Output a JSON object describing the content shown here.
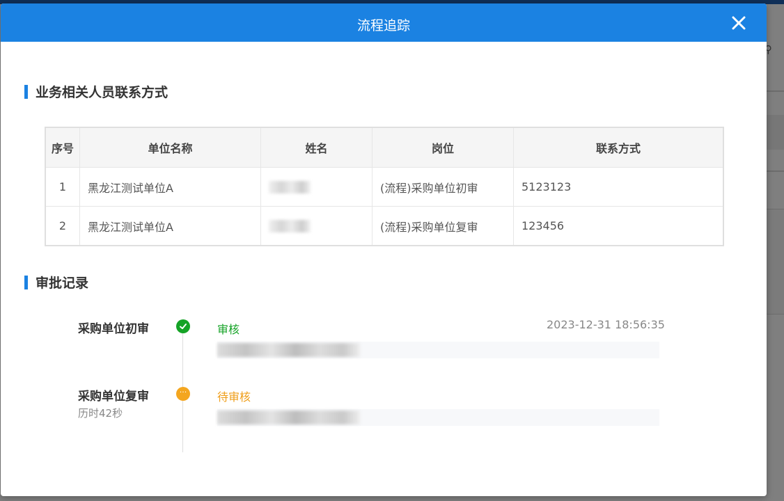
{
  "modal": {
    "title": "流程追踪"
  },
  "contacts": {
    "section_title": "业务相关人员联系方式",
    "columns": [
      "序号",
      "单位名称",
      "姓名",
      "岗位",
      "联系方式"
    ],
    "rows": [
      {
        "index": "1",
        "unit": "黑龙江测试单位A",
        "name": "",
        "position": "(流程)采购单位初审",
        "contact": "5123123"
      },
      {
        "index": "2",
        "unit": "黑龙江测试单位A",
        "name": "",
        "position": "(流程)采购单位复审",
        "contact": "123456"
      }
    ]
  },
  "approvals": {
    "section_title": "审批记录",
    "steps": [
      {
        "name": "采购单位初审",
        "duration": "",
        "status": "审核",
        "time": "2023-12-31 18:56:35",
        "status_color": "#15a326",
        "icon": "check-icon"
      },
      {
        "name": "采购单位复审",
        "duration": "历时42秒",
        "status": "待审核",
        "time": "",
        "status_color": "#ef9e1a",
        "icon": "ellipsis-icon"
      }
    ]
  },
  "colors": {
    "header": "#1b82e2",
    "accent": "#1b82e2",
    "done": "#15a326",
    "pending": "#f4a61f"
  }
}
